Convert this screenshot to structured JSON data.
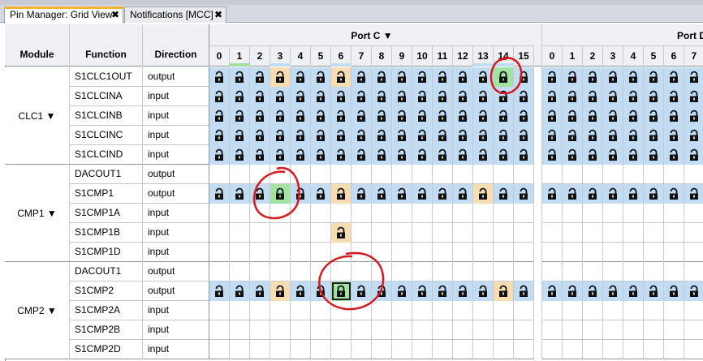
{
  "tabs": [
    {
      "label": "Pin Manager: Grid View",
      "active": true
    },
    {
      "label": "Notifications [MCC]",
      "active": false
    }
  ],
  "tab_close_glyph": "✖",
  "headers": {
    "module": "Module",
    "function": "Function",
    "direction": "Direction"
  },
  "ports": [
    {
      "label": "Port C ▼",
      "pins": [
        "0",
        "1",
        "2",
        "3",
        "4",
        "5",
        "6",
        "7",
        "8",
        "9",
        "10",
        "11",
        "12",
        "13",
        "14",
        "15"
      ]
    },
    {
      "label": "Port D",
      "pins": [
        "0",
        "1",
        "2",
        "3",
        "4",
        "5",
        "6",
        "7"
      ]
    }
  ],
  "header_pin_markers": {
    "1": "#a6dba4",
    "3": "#c2dcf3",
    "6": "#c2dcf3",
    "13": "#c2dcf3",
    "14": "#c2dcf3"
  },
  "colors": {
    "blue": "#c2dcf3",
    "orange": "#f8ddb3",
    "green": "#a3e3a1",
    "annotation": "#d71920"
  },
  "icons": {
    "lock_open": "unlocked-padlock-icon",
    "lock_closed": "locked-padlock-icon"
  },
  "modules": [
    {
      "label": "CLC1 ▼",
      "rows": [
        {
          "function": "S1CLC1OUT",
          "direction": "output",
          "portC": "BBBOBBOBBBBBBBGB",
          "portD": "BBBBBBBB",
          "closed": [
            14
          ]
        },
        {
          "function": "S1CLCINA",
          "direction": "input",
          "portC": "BBBBBBBBBBBBBBBB",
          "portD": "BBBBBBBB"
        },
        {
          "function": "S1CLCINB",
          "direction": "input",
          "portC": "BBBBBBBBBBBBBBBB",
          "portD": "BBBBBBBB"
        },
        {
          "function": "S1CLCINC",
          "direction": "input",
          "portC": "BBBBBBBBBBBBBBBB",
          "portD": "BBBBBBBB"
        },
        {
          "function": "S1CLCIND",
          "direction": "input",
          "portC": "BBBBBBBBBBBBBBBB",
          "portD": "BBBBBBBB"
        }
      ]
    },
    {
      "label": "CMP1 ▼",
      "rows": [
        {
          "function": "DACOUT1",
          "direction": "output",
          "portC": "................",
          "portD": "........"
        },
        {
          "function": "S1CMP1",
          "direction": "output",
          "portC": "BBBGBBOBBBBBBOBB",
          "portD": "BBBBBBBB",
          "closed": [
            3
          ]
        },
        {
          "function": "S1CMP1A",
          "direction": "input",
          "portC": "................",
          "portD": "........"
        },
        {
          "function": "S1CMP1B",
          "direction": "input",
          "portC": "......O.........",
          "portD": "........"
        },
        {
          "function": "S1CMP1D",
          "direction": "input",
          "portC": "................",
          "portD": "........"
        }
      ]
    },
    {
      "label": "CMP2 ▼",
      "rows": [
        {
          "function": "DACOUT1",
          "direction": "output",
          "portC": "................",
          "portD": "........"
        },
        {
          "function": "S1CMP2",
          "direction": "output",
          "portC": "BBBOBBGBBBBBBBOB",
          "portD": "BBBBBBBB",
          "closed": [
            6
          ],
          "selected": [
            6
          ]
        },
        {
          "function": "S1CMP2A",
          "direction": "input",
          "portC": "................",
          "portD": "........"
        },
        {
          "function": "S1CMP2B",
          "direction": "input",
          "portC": "................",
          "portD": "........"
        },
        {
          "function": "S1CMP2D",
          "direction": "input",
          "portC": "................",
          "portD": "........"
        }
      ]
    }
  ]
}
